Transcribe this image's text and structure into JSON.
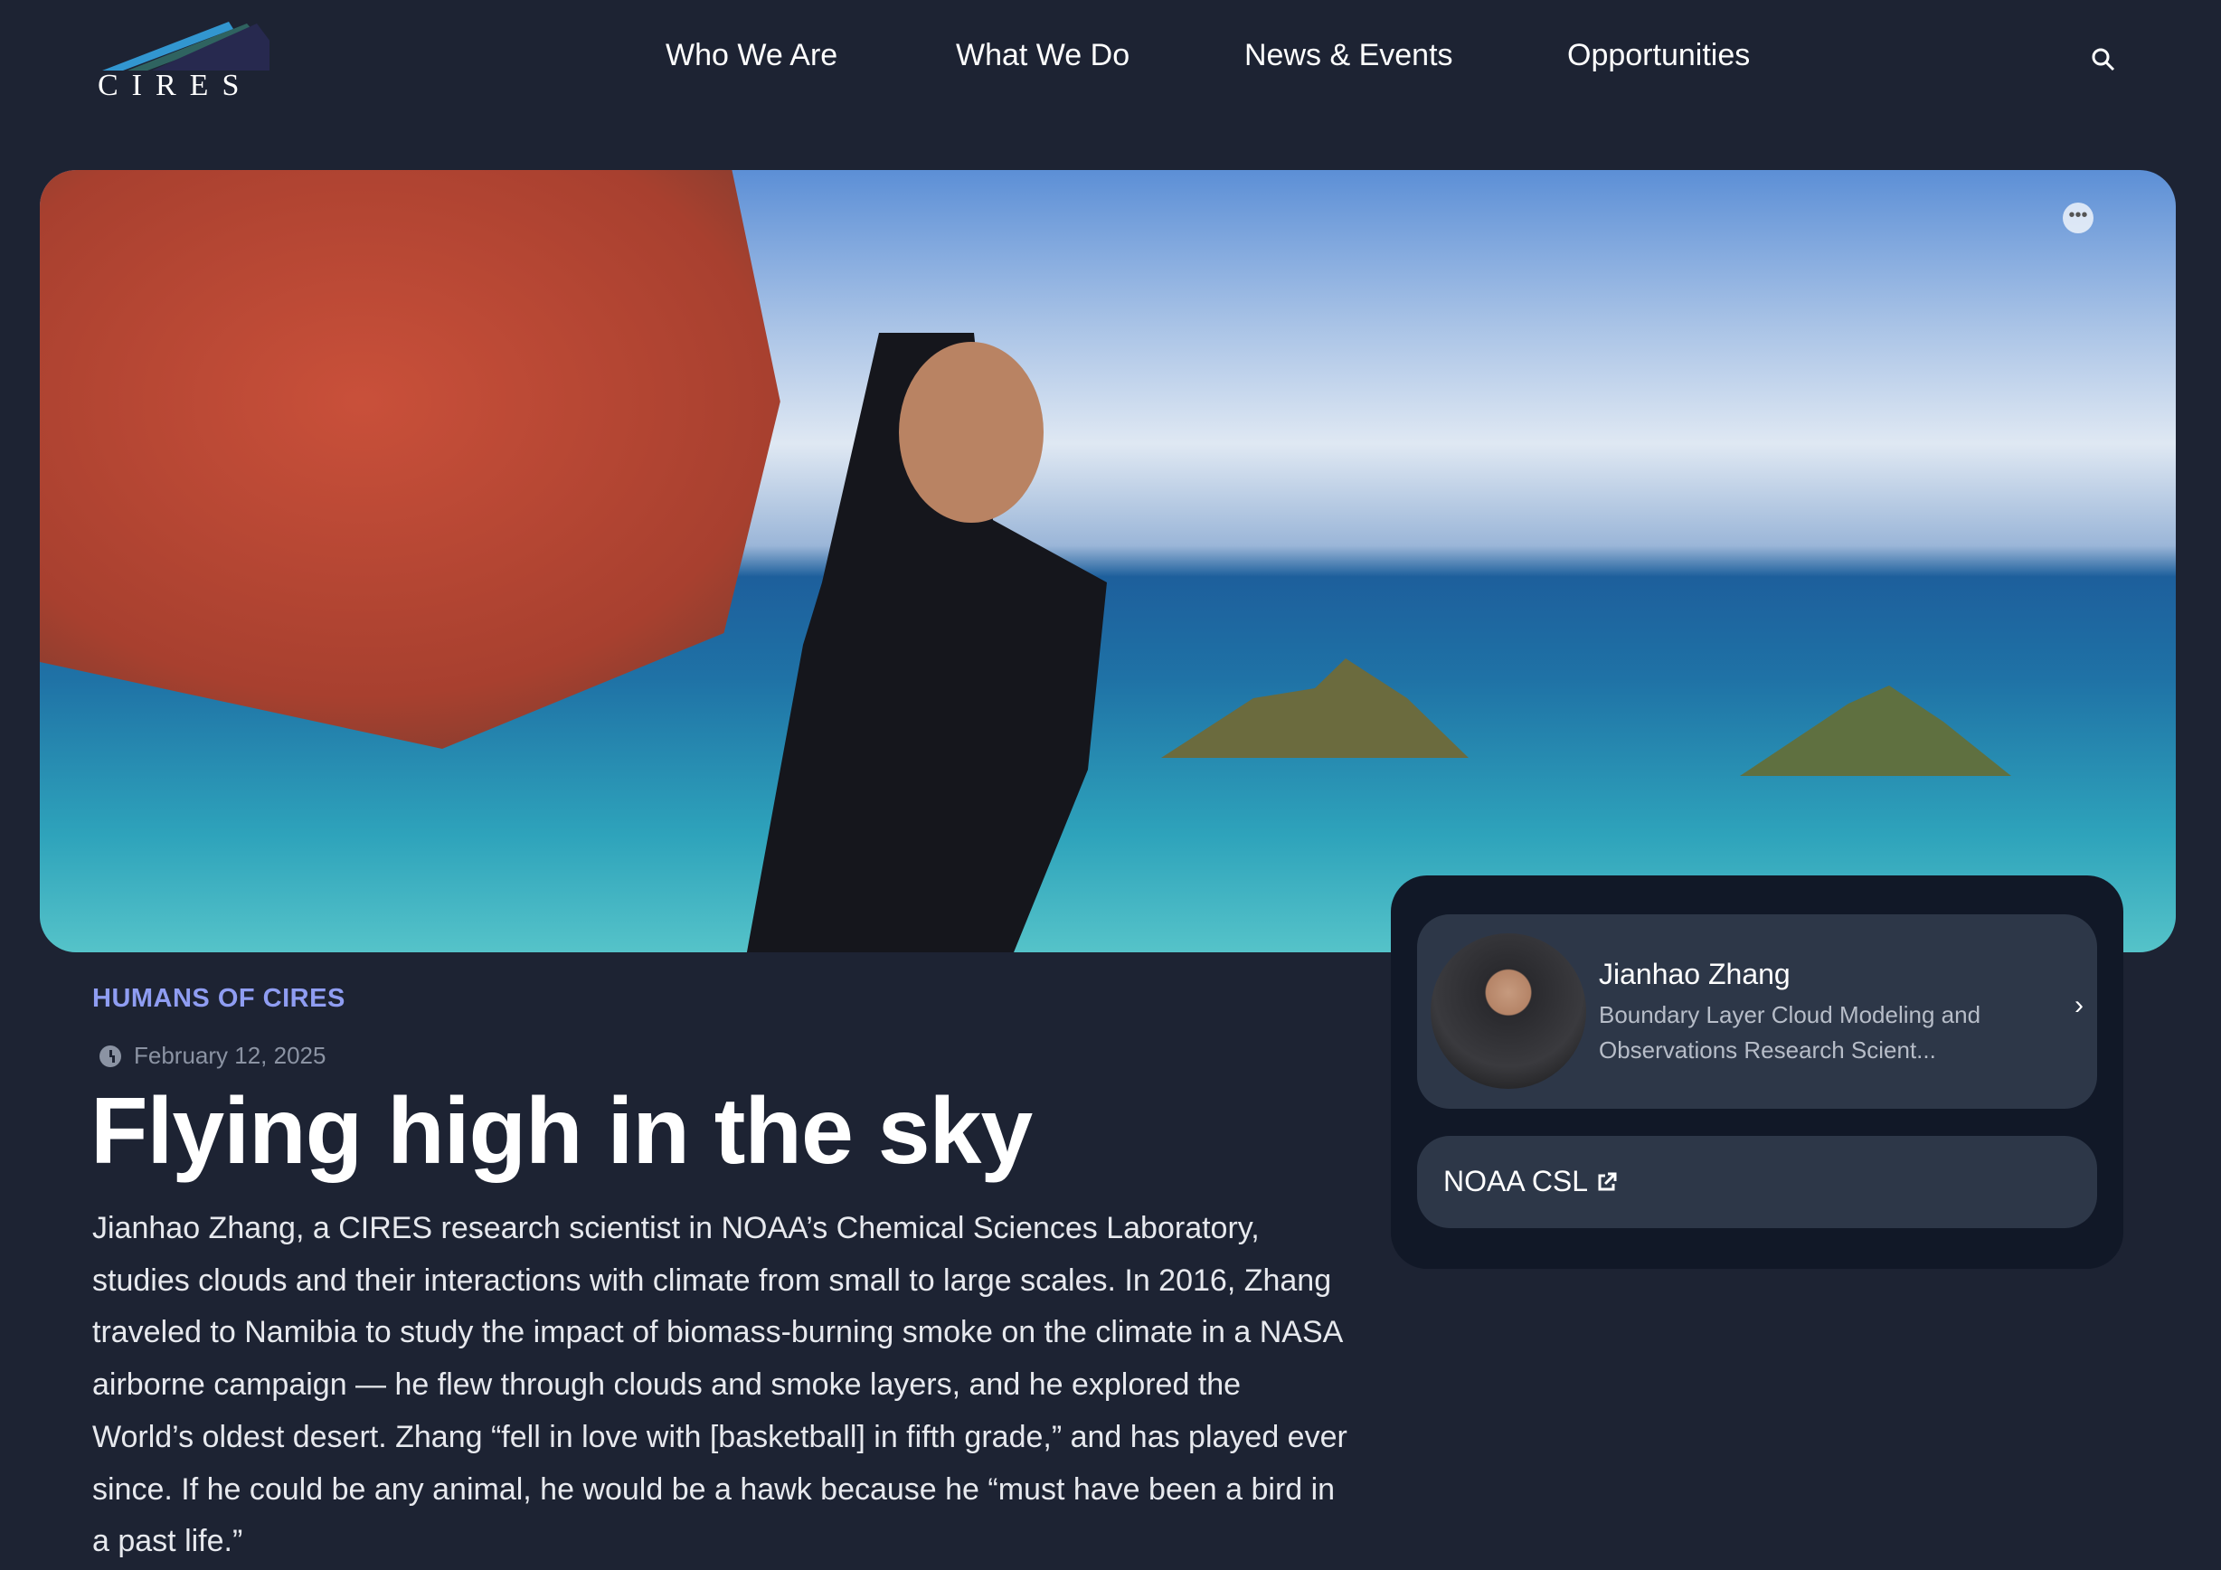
{
  "header": {
    "logo_text": "CIRES",
    "nav": [
      "Who We Are",
      "What We Do",
      "News & Events",
      "Opportunities"
    ],
    "search_icon": "search-icon"
  },
  "hero": {
    "more_icon": "more-horizontal-icon"
  },
  "article": {
    "category": "HUMANS OF CIRES",
    "date": "February 12, 2025",
    "title": "Flying high in the sky",
    "body": "Jianhao Zhang, a CIRES research scientist in NOAA’s Chemical Sciences Laboratory, studies clouds and their interactions with climate from small to large scales. In 2016, Zhang traveled to Namibia to study the impact of biomass-burning smoke on the climate in a NASA airborne campaign — he flew through clouds and smoke layers, and he explored the World’s oldest desert. Zhang “fell in love with [basketball] in fifth grade,” and has played ever since. If he could be any animal, he would be a hawk because he “must have been a bird in a past life.”"
  },
  "sidebar": {
    "person": {
      "name": "Jianhao Zhang",
      "role": "Boundary Layer Cloud Modeling and Observations Research Scient..."
    },
    "link": {
      "label": "NOAA CSL",
      "icon": "external-link-icon"
    }
  },
  "colors": {
    "background": "#1d2333",
    "accent": "#8f9df2",
    "card": "#2d3748",
    "panel": "#111827"
  }
}
